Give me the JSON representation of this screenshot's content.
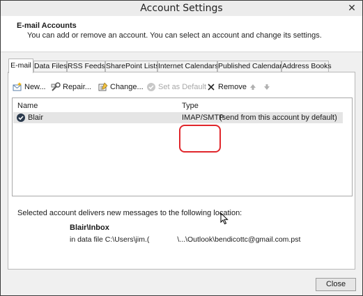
{
  "window": {
    "title": "Account Settings",
    "close_glyph": "✕"
  },
  "header": {
    "title": "E-mail Accounts",
    "subtitle": "You can add or remove an account. You can select an account and change its settings."
  },
  "tabs": [
    {
      "label": "E-mail",
      "active": true
    },
    {
      "label": "Data Files"
    },
    {
      "label": "RSS Feeds"
    },
    {
      "label": "SharePoint Lists"
    },
    {
      "label": "Internet Calendars"
    },
    {
      "label": "Published Calendars"
    },
    {
      "label": "Address Books"
    }
  ],
  "toolbar": {
    "new_label": "New...",
    "repair_label": "Repair...",
    "change_label": "Change...",
    "default_label": "Set as Default",
    "remove_label": "Remove",
    "icons": [
      "new-account-icon",
      "repair-icon",
      "change-icon",
      "check-icon",
      "remove-x-icon",
      "up-arrow-icon",
      "down-arrow-icon"
    ]
  },
  "list": {
    "columns": [
      "Name",
      "Type"
    ],
    "rows": [
      {
        "name": "Blair",
        "type": "IMAP/SMTP",
        "note": "(send from this account by default)"
      }
    ]
  },
  "delivery": {
    "label": "Selected account delivers new messages to the following location:",
    "folder": "Blair\\Inbox",
    "path_prefix": "in data file C:\\Users\\jim.(",
    "path_suffix": "\\...\\Outlook\\bendicottc@gmail.com.pst"
  },
  "footer": {
    "close_label": "Close"
  },
  "colors": {
    "callout": "#e0262b",
    "selected_row": "#e5e5e5"
  }
}
